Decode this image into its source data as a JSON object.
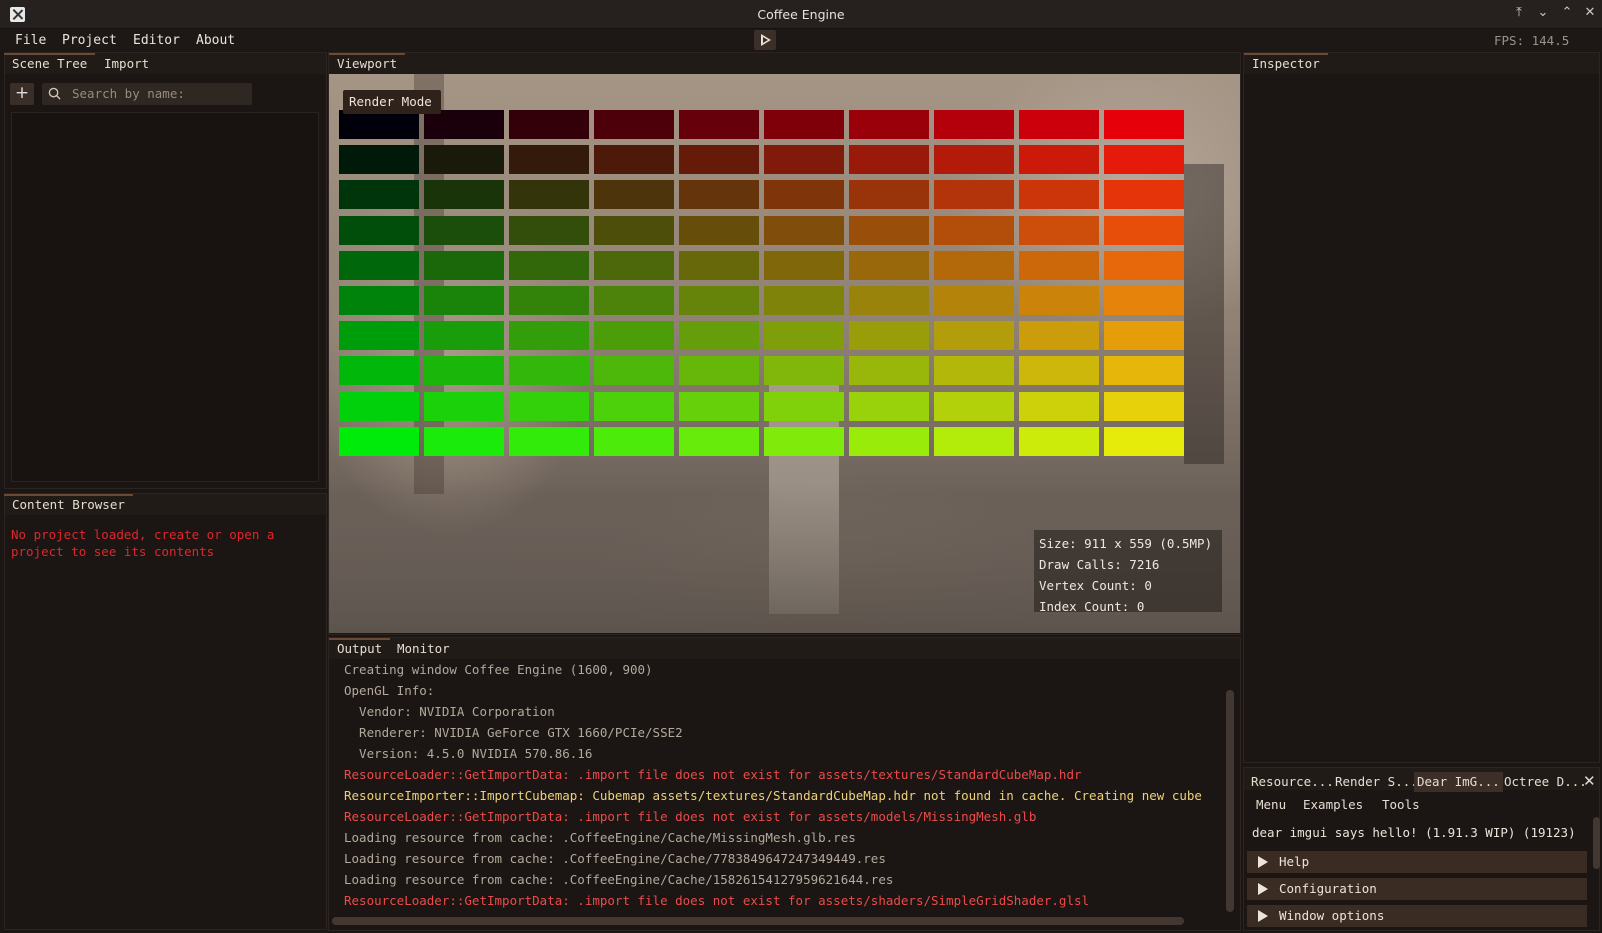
{
  "window": {
    "title": "Coffee Engine",
    "controls": [
      "⤒",
      "⌄",
      "⌃",
      "✕"
    ]
  },
  "menubar": {
    "items": [
      "File",
      "Project",
      "Editor",
      "About"
    ],
    "fps": "FPS: 144.5"
  },
  "left_top": {
    "tabs": [
      "Scene Tree",
      "Import"
    ],
    "add_label": "+",
    "search_placeholder": "Search by name:"
  },
  "left_bottom": {
    "tab": "Content Browser",
    "message": "No project loaded, create or open a project to see its contents"
  },
  "viewport": {
    "tab": "Viewport",
    "render_mode": "Render Mode",
    "stats": [
      "Size: 911 x 559 (0.5MP)",
      "Draw Calls: 7216",
      "Vertex Count: 0",
      "Index Count: 0"
    ]
  },
  "inspector": {
    "tab": "Inspector"
  },
  "output": {
    "tabs": [
      "Output",
      "Monitor"
    ],
    "lines": [
      {
        "text": "Creating window Coffee Engine (1600, 900)",
        "level": "info"
      },
      {
        "text": "OpenGL Info:",
        "level": "info"
      },
      {
        "text": "  Vendor: NVIDIA Corporation",
        "level": "info"
      },
      {
        "text": "  Renderer: NVIDIA GeForce GTX 1660/PCIe/SSE2",
        "level": "info"
      },
      {
        "text": "  Version: 4.5.0 NVIDIA 570.86.16",
        "level": "info"
      },
      {
        "text": "ResourceLoader::GetImportData: .import file does not exist for assets/textures/StandardCubeMap.hdr",
        "level": "error"
      },
      {
        "text": "ResourceImporter::ImportCubemap: Cubemap assets/textures/StandardCubeMap.hdr not found in cache. Creating new cube",
        "level": "warn"
      },
      {
        "text": "ResourceLoader::GetImportData: .import file does not exist for assets/models/MissingMesh.glb",
        "level": "error"
      },
      {
        "text": "Loading resource from cache: .CoffeeEngine/Cache/MissingMesh.glb.res",
        "level": "info"
      },
      {
        "text": "Loading resource from cache: .CoffeeEngine/Cache/7783849647247349449.res",
        "level": "info"
      },
      {
        "text": "Loading resource from cache: .CoffeeEngine/Cache/15826154127959621644.res",
        "level": "info"
      },
      {
        "text": "ResourceLoader::GetImportData: .import file does not exist for assets/shaders/SimpleGridShader.glsl",
        "level": "error"
      }
    ]
  },
  "bottom_right": {
    "tabs": [
      "Resource...",
      "Render S...",
      "Dear ImG...",
      "Octree D..."
    ],
    "close": "✕",
    "menu": [
      "Menu",
      "Examples",
      "Tools"
    ],
    "hello": "dear imgui says hello! (1.91.3 WIP) (19123)",
    "sections": [
      "Help",
      "Configuration",
      "Window options"
    ]
  },
  "colors": {
    "error": "#ea4b4b",
    "warn": "#ecd17a",
    "info": "#b3a89c",
    "accent": "#6a4a34"
  }
}
